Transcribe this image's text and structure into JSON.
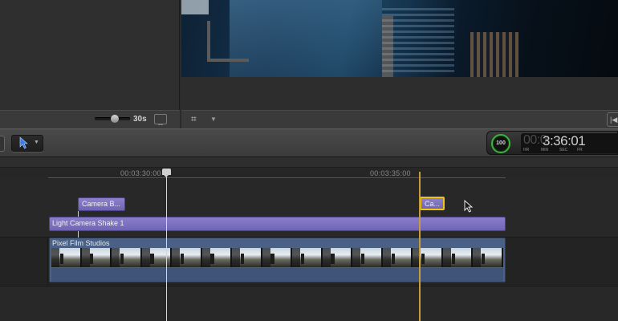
{
  "browser": {
    "zoom_value": "30s",
    "zoom_level": 0.5
  },
  "toolbar": {
    "tool": "select-arrow-icon"
  },
  "dashboard": {
    "progress": "100",
    "timecode_dim": "00:0",
    "timecode_main": "3:36:01",
    "units": [
      "HR",
      "MIN",
      "SEC",
      "FR"
    ]
  },
  "timeline": {
    "ruler_ticks": [
      "00:03:30:00",
      "00:03:35:00"
    ],
    "clips": {
      "camera_b": "Camera B...",
      "camera_selected": "Ca...",
      "shake": "Light Camera Shake 1",
      "main": "Pixel Film Studios"
    },
    "frame_count": 15
  },
  "colors": {
    "title_clip": "#7d72c4",
    "primary_clip": "#4a6185",
    "selection": "#f0c419",
    "skimmer": "#c79a3a",
    "progress": "#3bb33b"
  }
}
